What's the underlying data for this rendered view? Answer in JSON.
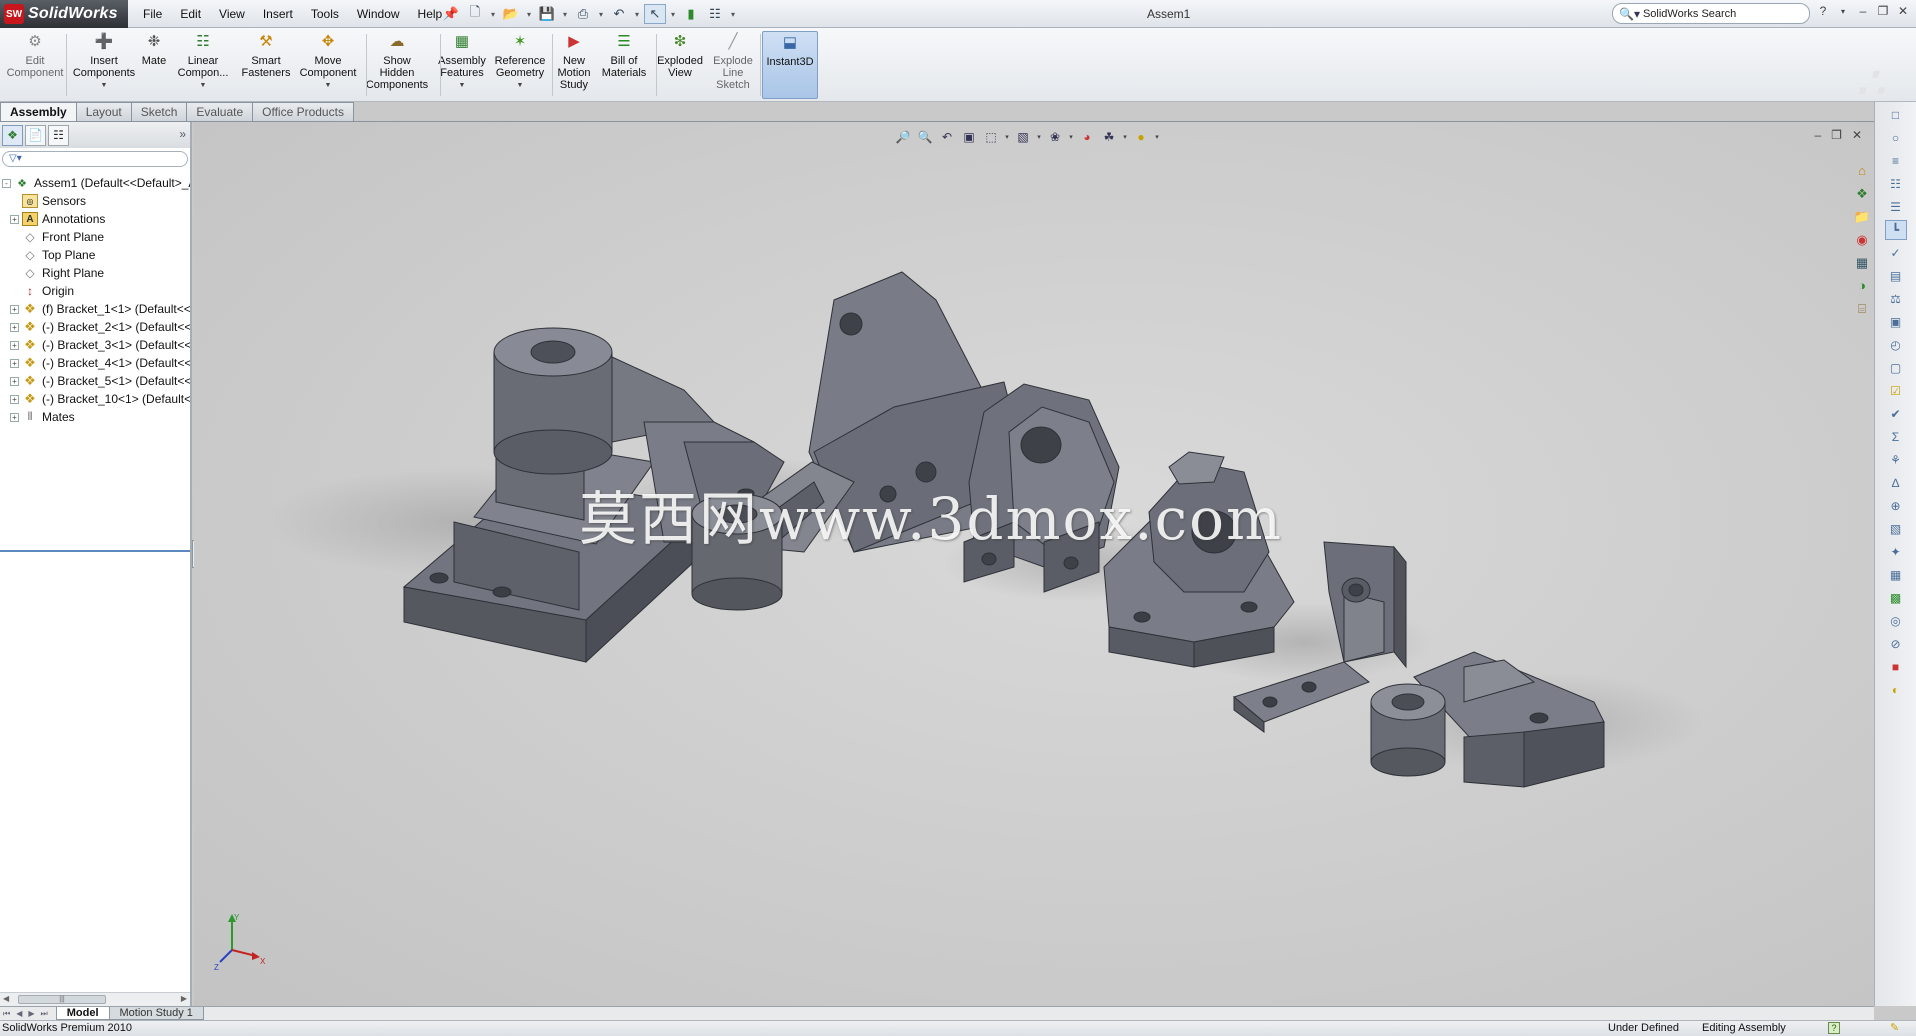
{
  "app": {
    "logo_badge": "SW",
    "logo_text": "SolidWorks",
    "document_title": "Assem1"
  },
  "menu": [
    "File",
    "Edit",
    "View",
    "Insert",
    "Tools",
    "Window",
    "Help"
  ],
  "search": {
    "placeholder": "SolidWorks Search"
  },
  "ribbon": [
    {
      "label": "Edit\nComponent",
      "icon": "edit-component-icon",
      "dim": true
    },
    {
      "label": "Insert\nComponents",
      "icon": "insert-components-icon",
      "dropdown": true
    },
    {
      "label": "Mate",
      "icon": "mate-icon"
    },
    {
      "label": "Linear\nCompon...",
      "icon": "linear-pattern-icon",
      "dropdown": true
    },
    {
      "label": "Smart\nFasteners",
      "icon": "smart-fasteners-icon"
    },
    {
      "label": "Move\nComponent",
      "icon": "move-component-icon",
      "dropdown": true
    },
    {
      "label": "Show\nHidden\nComponents",
      "icon": "show-hidden-icon"
    },
    {
      "label": "Assembly\nFeatures",
      "icon": "assembly-features-icon",
      "dropdown": true
    },
    {
      "label": "Reference\nGeometry",
      "icon": "reference-geometry-icon",
      "dropdown": true
    },
    {
      "label": "New\nMotion\nStudy",
      "icon": "motion-study-icon"
    },
    {
      "label": "Bill of\nMaterials",
      "icon": "bom-icon"
    },
    {
      "label": "Exploded\nView",
      "icon": "exploded-view-icon"
    },
    {
      "label": "Explode\nLine\nSketch",
      "icon": "explode-line-icon",
      "dim": true
    },
    {
      "label": "Instant3D",
      "icon": "instant3d-icon",
      "pressed": true
    }
  ],
  "tabs": [
    "Assembly",
    "Layout",
    "Sketch",
    "Evaluate",
    "Office Products"
  ],
  "feature_tree": [
    {
      "label": "Assem1  (Default<<Default>_A|",
      "icon": "assembly",
      "expander": "-",
      "indent": 0
    },
    {
      "label": "Sensors",
      "icon": "sensor",
      "expander": "",
      "indent": 1
    },
    {
      "label": "Annotations",
      "icon": "annot",
      "expander": "+",
      "indent": 1
    },
    {
      "label": "Front Plane",
      "icon": "plane",
      "expander": "",
      "indent": 1
    },
    {
      "label": "Top Plane",
      "icon": "plane",
      "expander": "",
      "indent": 1
    },
    {
      "label": "Right Plane",
      "icon": "plane",
      "expander": "",
      "indent": 1
    },
    {
      "label": "Origin",
      "icon": "origin",
      "expander": "",
      "indent": 1
    },
    {
      "label": "(f) Bracket_1<1> (Default<<",
      "icon": "part",
      "expander": "+",
      "indent": 1
    },
    {
      "label": "(-) Bracket_2<1> (Default<<",
      "icon": "part",
      "expander": "+",
      "indent": 1
    },
    {
      "label": "(-) Bracket_3<1> (Default<<",
      "icon": "part",
      "expander": "+",
      "indent": 1
    },
    {
      "label": "(-) Bracket_4<1> (Default<<",
      "icon": "part",
      "expander": "+",
      "indent": 1
    },
    {
      "label": "(-) Bracket_5<1> (Default<<",
      "icon": "part",
      "expander": "+",
      "indent": 1
    },
    {
      "label": "(-) Bracket_10<1> (Default<",
      "icon": "part",
      "expander": "+",
      "indent": 1
    },
    {
      "label": "Mates",
      "icon": "mates",
      "expander": "+",
      "indent": 1
    }
  ],
  "viewport": {
    "watermark": "莫西网www.3dmox.com"
  },
  "bottom_tabs": [
    "Model",
    "Motion Study 1"
  ],
  "status": {
    "product": "SolidWorks Premium 2010",
    "state1": "Under Defined",
    "state2": "Editing Assembly",
    "help": "?"
  },
  "colors": {
    "part": "#6b6e78",
    "part_light": "#8c909a",
    "part_dark": "#4a4d55",
    "viewport": "#cfcfcf",
    "accent": "#5d89c2"
  }
}
